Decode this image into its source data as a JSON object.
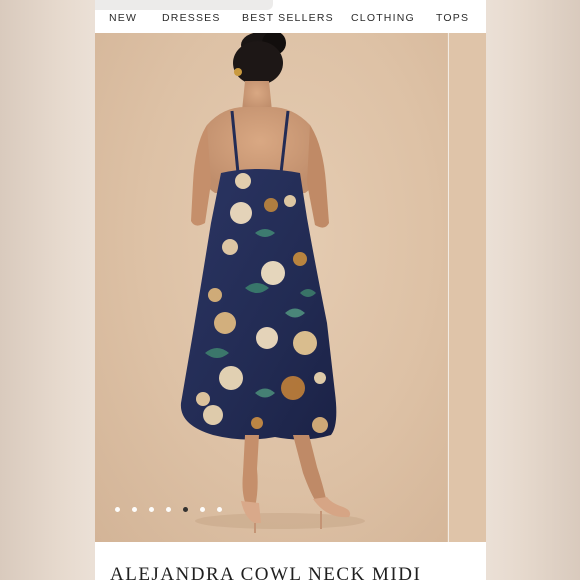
{
  "nav": {
    "items": [
      "NEW",
      "DRESSES",
      "BEST SELLERS",
      "CLOTHING",
      "TOPS"
    ]
  },
  "gallery": {
    "slide_count": 7,
    "active_index": 4,
    "image_desc": "navy-floral-midi-dress-back-view"
  },
  "product": {
    "title": "ALEJANDRA COWL NECK MIDI"
  },
  "colors": {
    "background": "#ebe0d6",
    "photo_backdrop": "#dcc1a6",
    "dress_navy": "#232c55",
    "dot_active": "#2a2a2a",
    "dot_inactive": "#ffffff"
  }
}
